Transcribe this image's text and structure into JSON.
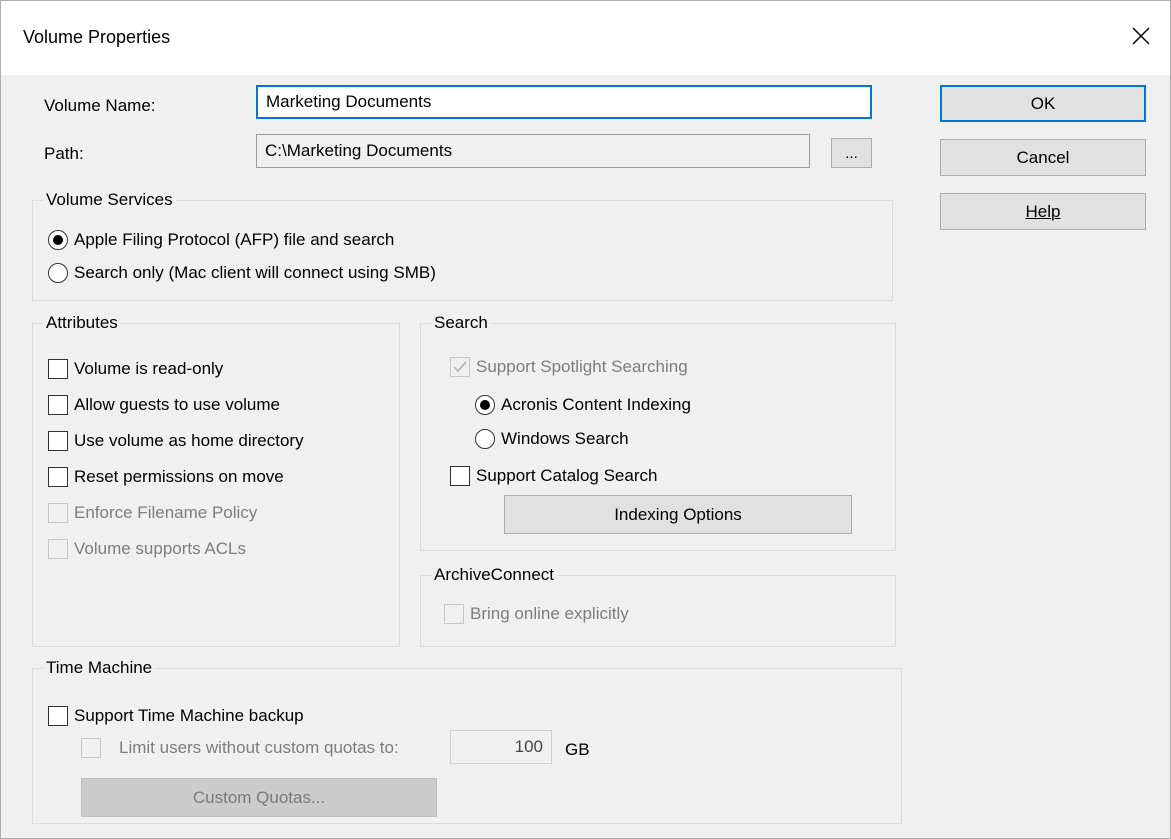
{
  "dialog": {
    "title": "Volume Properties",
    "close_glyph": "✕"
  },
  "fields": {
    "volume_name_label": "Volume Name:",
    "volume_name_value": "Marketing Documents",
    "path_label": "Path:",
    "path_value": "C:\\Marketing Documents",
    "browse_label": "..."
  },
  "buttons": {
    "ok": "OK",
    "cancel": "Cancel",
    "help": "Help"
  },
  "volume_services": {
    "title": "Volume Services",
    "options": [
      {
        "label": "Apple Filing Protocol (AFP) file and search",
        "selected": true
      },
      {
        "label": "Search only (Mac client will connect using SMB)",
        "selected": false
      }
    ]
  },
  "attributes": {
    "title": "Attributes",
    "items": [
      {
        "label": "Volume is read-only",
        "checked": false,
        "enabled": true
      },
      {
        "label": "Allow guests to use volume",
        "checked": false,
        "enabled": true
      },
      {
        "label": "Use volume as home directory",
        "checked": false,
        "enabled": true
      },
      {
        "label": "Reset permissions on move",
        "checked": false,
        "enabled": true
      },
      {
        "label": "Enforce Filename Policy",
        "checked": false,
        "enabled": false
      },
      {
        "label": "Volume supports ACLs",
        "checked": false,
        "enabled": false
      }
    ]
  },
  "search": {
    "title": "Search",
    "spotlight_label": "Support Spotlight Searching",
    "indexing_options": [
      {
        "label": "Acronis Content Indexing",
        "selected": true
      },
      {
        "label": "Windows Search",
        "selected": false
      }
    ],
    "catalog_label": "Support Catalog Search",
    "indexing_button": "Indexing Options"
  },
  "archive_connect": {
    "title": "ArchiveConnect",
    "bring_online_label": "Bring online explicitly"
  },
  "time_machine": {
    "title": "Time Machine",
    "support_label": "Support Time Machine backup",
    "limit_label": "Limit users without custom quotas to:",
    "limit_value": "100",
    "unit": "GB",
    "custom_quotas_button": "Custom Quotas..."
  },
  "colors": {
    "focus_border": "#0078d7",
    "dialog_bg": "#f0f0f0"
  },
  "icons": {
    "close": "close-icon",
    "check": "check-icon"
  }
}
